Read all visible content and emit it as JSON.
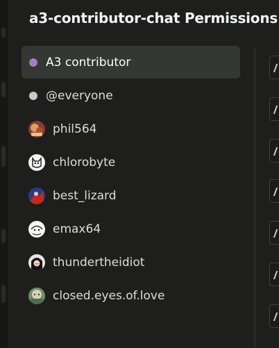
{
  "header": {
    "title": "a3-contributor-chat Permissions"
  },
  "colors": {
    "role_a3_contributor": "#a27fbf",
    "role_everyone": "#c9c9cd",
    "selected_bg": "#353733"
  },
  "members_list": [
    {
      "label": "A3 contributor",
      "kind": "role",
      "icon": "role-dot-icon",
      "selected": true
    },
    {
      "label": "@everyone",
      "kind": "role",
      "icon": "role-dot-icon",
      "selected": false
    },
    {
      "label": "phil564",
      "kind": "member",
      "icon": "avatar-icon",
      "selected": false
    },
    {
      "label": "chlorobyte",
      "kind": "member",
      "icon": "avatar-icon",
      "selected": false
    },
    {
      "label": "best_lizard",
      "kind": "member",
      "icon": "avatar-icon",
      "selected": false
    },
    {
      "label": "emax64",
      "kind": "member",
      "icon": "avatar-icon",
      "selected": false
    },
    {
      "label": "thundertheidiot",
      "kind": "member",
      "icon": "avatar-icon",
      "selected": false
    },
    {
      "label": "closed.eyes.of.love",
      "kind": "member",
      "icon": "avatar-icon",
      "selected": false
    }
  ]
}
